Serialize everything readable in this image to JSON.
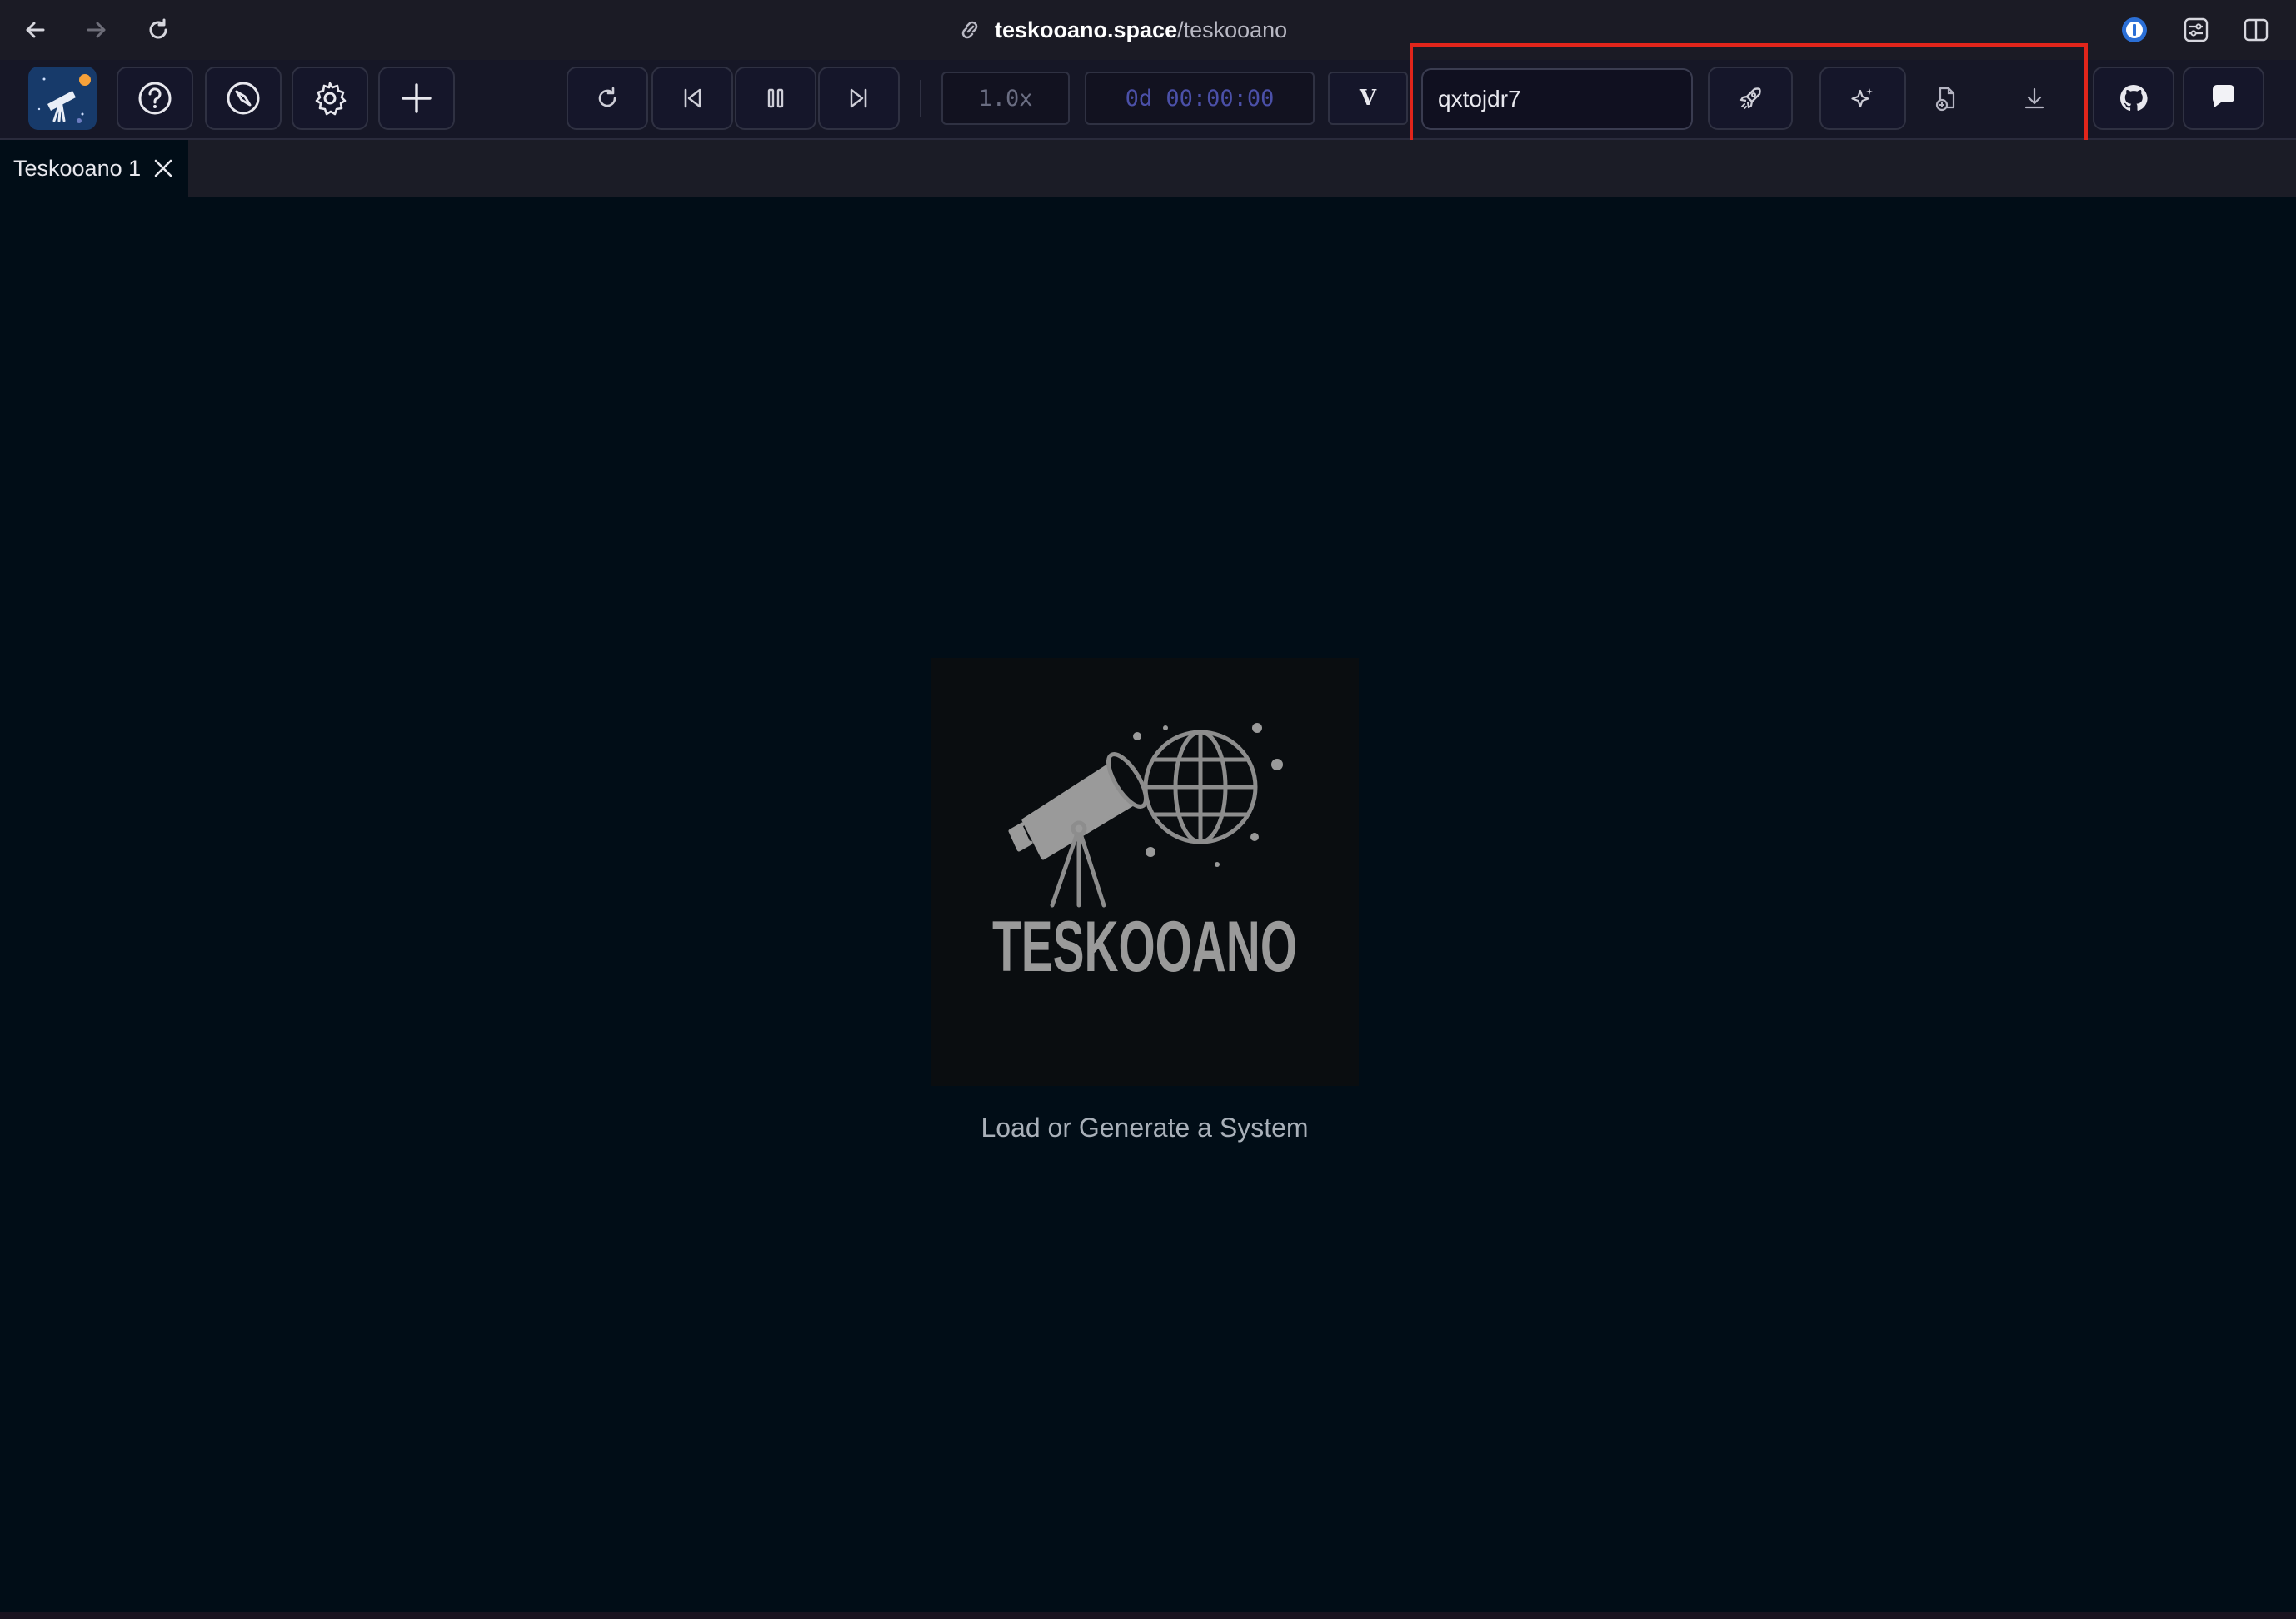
{
  "browser": {
    "url_host": "teskooano.space",
    "url_path": "/teskooano",
    "icons": {
      "back": "arrow-left-icon",
      "forward": "arrow-right-icon",
      "reload": "reload-icon",
      "link": "link-icon",
      "extension": "password-manager-icon",
      "settings": "sliders-icon",
      "sidebar": "sidebar-icon"
    }
  },
  "toolbar": {
    "speed": "1.0x",
    "time": "0d 00:00:00",
    "v_label": "V",
    "seed_value": "qxtojdr7",
    "icons": {
      "app_logo": "telescope-logo-icon",
      "help": "help-icon",
      "compass": "compass-icon",
      "settings": "gear-icon",
      "add": "plus-icon",
      "reset": "reset-icon",
      "step_back": "step-back-icon",
      "pause": "pause-icon",
      "step_forward": "step-forward-icon",
      "generate": "rocket-icon",
      "random": "sparkle-icon",
      "load_file": "file-upload-icon",
      "download": "download-icon",
      "github": "github-icon",
      "chat": "chat-icon"
    }
  },
  "tabs": [
    {
      "label": "Teskooano 1"
    }
  ],
  "main": {
    "logo_text": "TESKOOANO",
    "message": "Load or Generate a System"
  },
  "colors": {
    "background": "#010d17",
    "toolbar": "#161726",
    "highlight": "#e1251b",
    "accent_orange": "#f6a13a"
  }
}
